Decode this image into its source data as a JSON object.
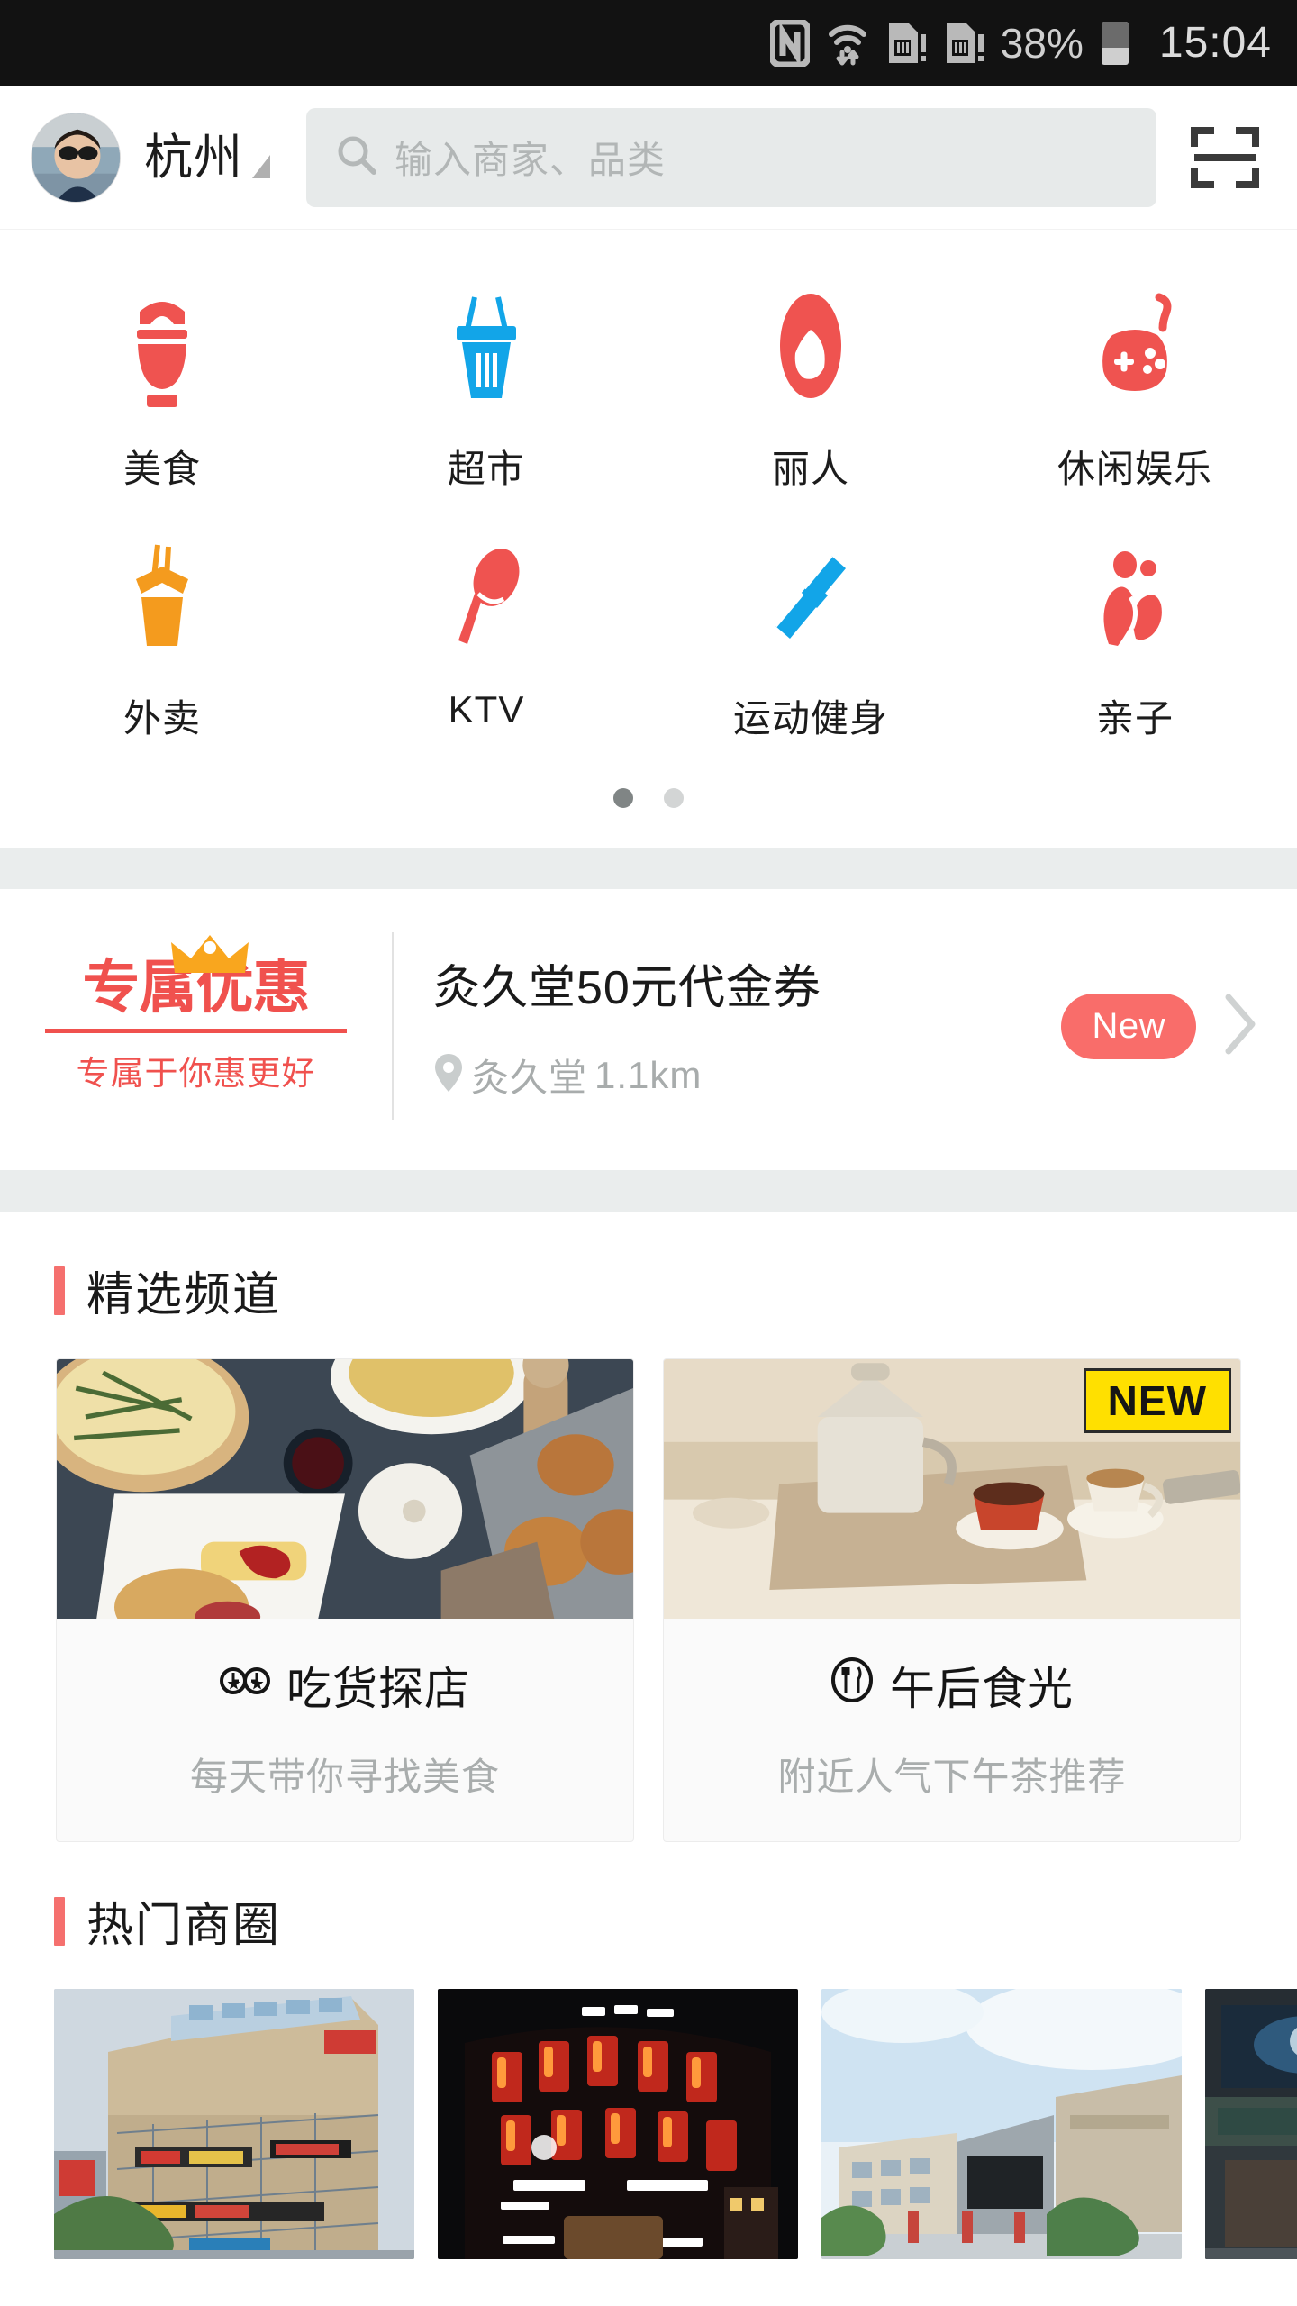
{
  "statusbar": {
    "icons": [
      "nfc-icon",
      "wifi-icon",
      "sim1-icon",
      "sim2-icon"
    ],
    "battery_percent": "38%",
    "time": "15:04"
  },
  "header": {
    "avatar_name": "user-avatar",
    "city": "杭州",
    "search": {
      "placeholder": "输入商家、品类",
      "value": ""
    },
    "scan_label": "scan-icon"
  },
  "categories": {
    "rows": [
      [
        {
          "label": "美食",
          "icon": "rice-bowl-icon",
          "color": "#ef5350"
        },
        {
          "label": "超市",
          "icon": "shopping-basket-icon",
          "color": "#12a5e8"
        },
        {
          "label": "丽人",
          "icon": "beauty-face-icon",
          "color": "#ef5350"
        },
        {
          "label": "休闲娱乐",
          "icon": "game-controller-icon",
          "color": "#ef5350"
        }
      ],
      [
        {
          "label": "外卖",
          "icon": "takeout-box-icon",
          "color": "#f49b1e"
        },
        {
          "label": "KTV",
          "icon": "microphone-icon",
          "color": "#ef5350"
        },
        {
          "label": "运动健身",
          "icon": "dumbbell-icon",
          "color": "#12a5e8"
        },
        {
          "label": "亲子",
          "icon": "parent-child-icon",
          "color": "#ef5350"
        }
      ]
    ],
    "pages": 2,
    "active_page": 1
  },
  "promo": {
    "badge_title": "专属优惠",
    "badge_sub": "专属于你惠更好",
    "title": "灸久堂50元代金券",
    "shop": "灸久堂",
    "distance": "1.1km",
    "tag": "New",
    "accent": "#f0514e"
  },
  "sections": [
    {
      "id": "featured-channels",
      "title": "精选频道"
    },
    {
      "id": "hot-districts",
      "title": "热门商圈"
    }
  ],
  "featured_cards": [
    {
      "title": "吃货探店",
      "subtitle": "每天带你寻找美食",
      "icon": "binoculars-icon",
      "badge": ""
    },
    {
      "title": "午后食光",
      "subtitle": "附近人气下午茶推荐",
      "icon": "fork-knife-circle-icon",
      "badge": "NEW"
    }
  ],
  "districts": [
    {
      "name": "district-photo-1"
    },
    {
      "name": "district-photo-2"
    },
    {
      "name": "district-photo-3"
    },
    {
      "name": "district-photo-4"
    }
  ]
}
